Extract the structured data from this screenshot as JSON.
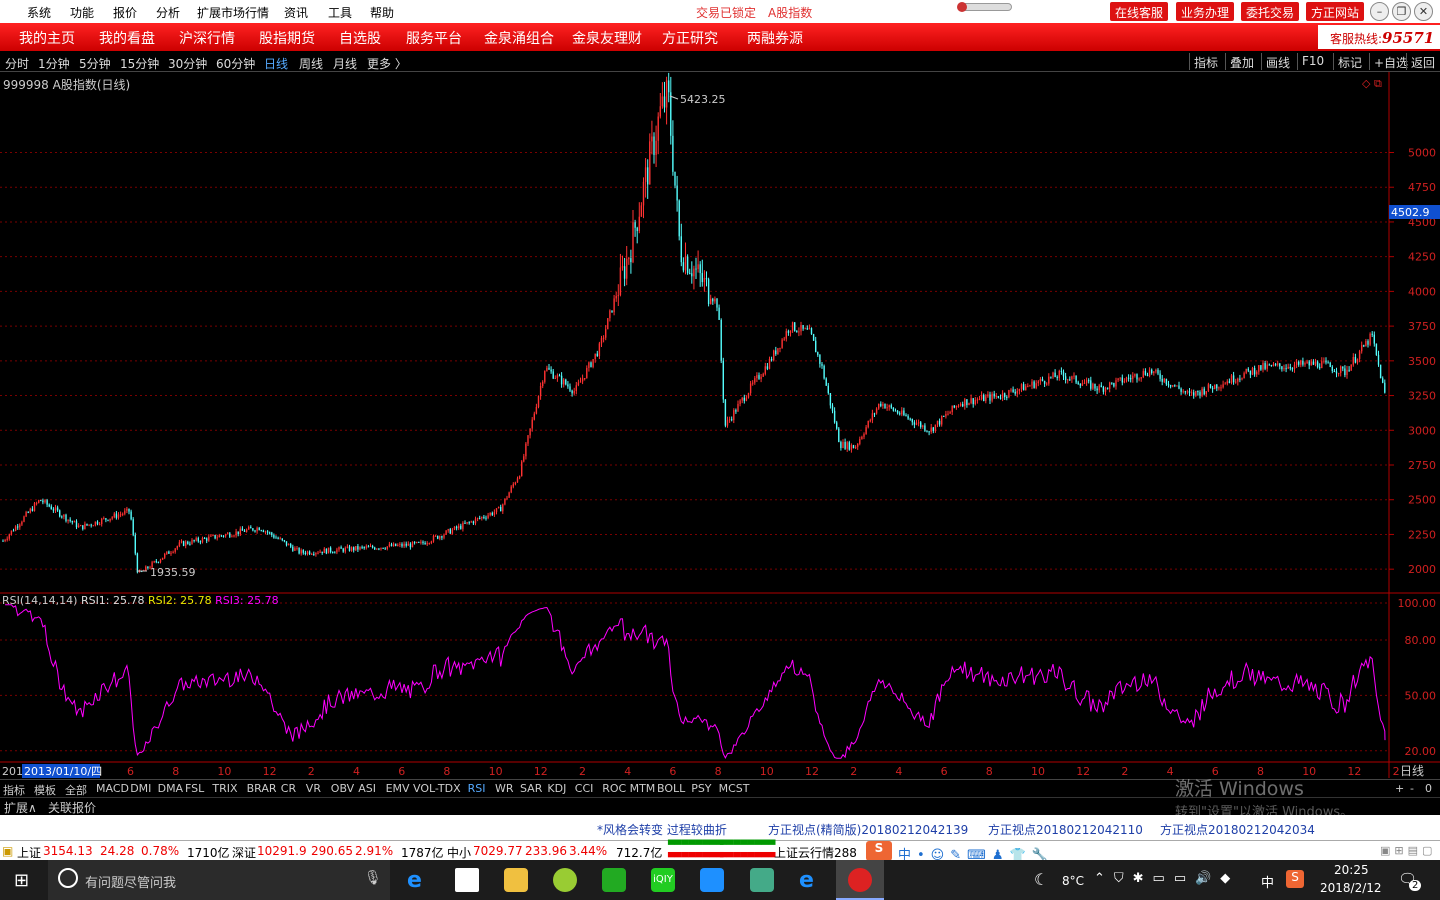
{
  "menubar": {
    "items": [
      "系统",
      "功能",
      "报价",
      "分析",
      "扩展市场行情",
      "资讯",
      "工具",
      "帮助"
    ],
    "lock_status": "交易已锁定",
    "index_label": "A股指数",
    "right_buttons": [
      "在线客服",
      "业务办理",
      "委托交易",
      "方正网站"
    ],
    "window_buttons": [
      "minimize-icon",
      "restore-icon",
      "close-icon"
    ]
  },
  "nav": {
    "items": [
      "我的主页",
      "我的看盘",
      "沪深行情",
      "股指期货",
      "自选股",
      "服务平台",
      "金泉涌组合",
      "金泉友理财",
      "方正研究",
      "两融券源"
    ],
    "hotline_label": "客服热线:",
    "hotline_number": "95571"
  },
  "period_bar": {
    "items": [
      "分时",
      "1分钟",
      "5分钟",
      "15分钟",
      "30分钟",
      "60分钟",
      "日线",
      "周线",
      "月线",
      "更多 〉"
    ],
    "active": "日线",
    "tools": [
      "指标",
      "叠加",
      "画线",
      "F10",
      "标记",
      "+自选",
      "返回"
    ]
  },
  "chart": {
    "instrument_title": "999998 A股指数(日线)",
    "high_label": "5423.25",
    "low_label": "1935.59",
    "current_price_tag": "4502.9",
    "rsi_title": "RSI(14,14,14)",
    "rsi1": "RSI1: 25.78",
    "rsi2": "RSI2: 25.78",
    "rsi3": "RSI3: 25.78",
    "cursor_date": "2013/01/10/四",
    "year_prefix": "201",
    "period_label": "日线"
  },
  "chart_data": {
    "type": "candlestick",
    "y_ticks": [
      2000,
      2250,
      2500,
      2750,
      3000,
      3250,
      3500,
      3750,
      4000,
      4250,
      4500,
      4750,
      5000
    ],
    "ylim": [
      1850,
      5450
    ],
    "rsi_ticks": [
      "100.00",
      "80.00",
      "50.00",
      "20.00"
    ],
    "rsi_ylim": [
      15,
      100
    ],
    "x_ticks": [
      "6",
      "8",
      "10",
      "12",
      "2",
      "4",
      "6",
      "8",
      "10",
      "12",
      "2",
      "4",
      "6",
      "8",
      "10",
      "12",
      "2",
      "4",
      "6",
      "8",
      "10",
      "12",
      "2",
      "4",
      "6",
      "8",
      "10",
      "12",
      "2"
    ],
    "close_anchors": [
      [
        0,
        2180
      ],
      [
        40,
        2500
      ],
      [
        80,
        2300
      ],
      [
        130,
        2420
      ],
      [
        138,
        1960
      ],
      [
        180,
        2180
      ],
      [
        260,
        2300
      ],
      [
        300,
        2120
      ],
      [
        420,
        2180
      ],
      [
        500,
        2430
      ],
      [
        520,
        2700
      ],
      [
        545,
        3450
      ],
      [
        575,
        3280
      ],
      [
        600,
        3600
      ],
      [
        630,
        4300
      ],
      [
        660,
        5280
      ],
      [
        668,
        5420
      ],
      [
        680,
        4300
      ],
      [
        700,
        4100
      ],
      [
        718,
        3900
      ],
      [
        725,
        3030
      ],
      [
        745,
        3250
      ],
      [
        770,
        3500
      ],
      [
        790,
        3750
      ],
      [
        810,
        3700
      ],
      [
        822,
        3450
      ],
      [
        840,
        2900
      ],
      [
        855,
        2880
      ],
      [
        880,
        3200
      ],
      [
        905,
        3100
      ],
      [
        930,
        3000
      ],
      [
        960,
        3200
      ],
      [
        1000,
        3250
      ],
      [
        1060,
        3400
      ],
      [
        1100,
        3300
      ],
      [
        1150,
        3430
      ],
      [
        1190,
        3250
      ],
      [
        1260,
        3450
      ],
      [
        1320,
        3480
      ],
      [
        1345,
        3420
      ],
      [
        1372,
        3680
      ],
      [
        1385,
        3250
      ]
    ]
  },
  "tabs": {
    "row1": [
      "指标",
      "模板",
      "全部",
      "MACD",
      "DMI",
      "DMA",
      "FSL",
      "TRIX",
      "BRAR",
      "CR",
      "VR",
      "OBV",
      "ASI",
      "EMV",
      "VOL-TDX",
      "RSI",
      "WR",
      "SAR",
      "KDJ",
      "CCI",
      "ROC",
      "MTM",
      "BOLL",
      "PSY",
      "MCST"
    ],
    "active": "RSI",
    "row1_right": [
      "+",
      "-",
      "0"
    ],
    "row2": [
      "扩展∧",
      "关联报价"
    ]
  },
  "news": [
    "*风格会转变 过程较曲折",
    "方正视点(精简版)20180212042139",
    "方正视点20180212042110",
    "方正视点20180212042034"
  ],
  "ticker": {
    "sh_name": "上证",
    "sh_value": "3154.13",
    "sh_change": "24.28",
    "sh_pct": "0.78%",
    "sh_vol": "1710亿",
    "sz_name": "深证",
    "sz_value": "10291.9",
    "sz_change": "290.65",
    "sz_pct": "2.91%",
    "sz_vol": "1787亿",
    "zx_name": "中小",
    "zx_value": "7029.77",
    "zx_change": "233.96",
    "zx_pct": "3.44%",
    "zx_vol": "712.7亿",
    "cloud": "上证云行情288"
  },
  "watermark": {
    "line1": "激活 Windows",
    "line2": "转到\"设置\"以激活 Windows。"
  },
  "taskbar": {
    "search_placeholder": "有问题尽管问我",
    "temperature": "8°C",
    "ime": "中",
    "time": "20:25",
    "date": "2018/2/12",
    "notification_count": "2"
  },
  "colors": {
    "up": "#ff3232",
    "down": "#54fcfc",
    "rsi": "#ff00ff",
    "grid": "#7a0000",
    "accent": "#d10000"
  }
}
